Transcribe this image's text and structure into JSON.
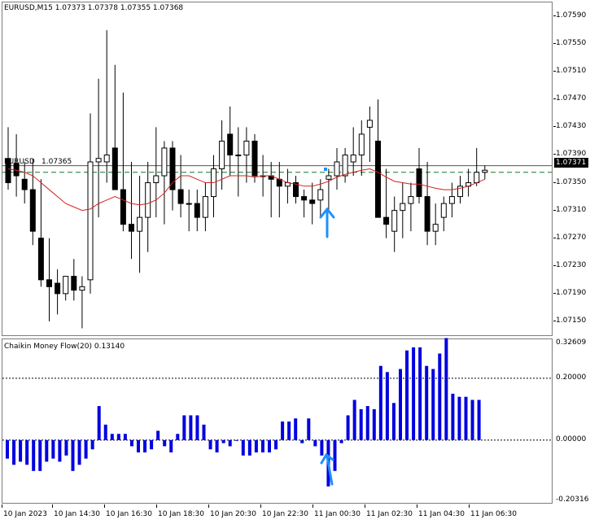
{
  "main_chart": {
    "title": "EURUSD,M15  1.07373 1.07378 1.07355 1.07368",
    "ma_label": "1.07365",
    "ma_prefix": "EURUSD",
    "current_price": "1.07371",
    "price_levels": [
      "1.07590",
      "1.07550",
      "1.07510",
      "1.07470",
      "1.07430",
      "1.07390",
      "1.07350",
      "1.07310",
      "1.07270",
      "1.07230",
      "1.07190",
      "1.07150"
    ],
    "colors": {
      "bull": "#ffffff",
      "bear": "#000000",
      "ma": "#d42020",
      "dashed": "#0a7a2a",
      "arrow": "#1e90ff"
    }
  },
  "indicator": {
    "title": "Chaikin Money Flow(20) 0.13140",
    "levels": [
      "0.32609",
      "0.20000",
      "0.00000",
      "-0.20316"
    ],
    "bar_color": "#0000e0"
  },
  "time_axis": [
    "10 Jan 2023",
    "10 Jan 14:30",
    "10 Jan 16:30",
    "10 Jan 18:30",
    "10 Jan 20:30",
    "10 Jan 22:30",
    "11 Jan 00:30",
    "11 Jan 02:30",
    "11 Jan 04:30",
    "11 Jan 06:30"
  ],
  "chart_data": [
    {
      "type": "candlestick",
      "title": "EURUSD,M15",
      "ohlc_open": [
        1.07385,
        1.07378,
        1.07355,
        1.0734,
        1.0727,
        1.0721,
        1.07205,
        1.0719,
        1.07215,
        1.07195,
        1.0721,
        1.0738,
        1.0738,
        1.074,
        1.0734,
        1.0729,
        1.0728,
        1.073,
        1.0735,
        1.0736,
        1.074,
        1.0734,
        1.0732,
        1.0732,
        1.073,
        1.0733,
        1.0737,
        1.0742,
        1.0739,
        1.0739,
        1.0741,
        1.0736,
        1.0736,
        1.07355,
        1.07345,
        1.0735,
        1.0733,
        1.07325,
        1.07325,
        1.07355,
        1.0736,
        1.0736,
        1.0738,
        1.0739,
        1.0743,
        1.0741,
        1.073,
        1.0728,
        1.0731,
        1.0732,
        1.0737,
        1.0733,
        1.0728,
        1.073,
        1.0732,
        1.0733,
        1.07345,
        1.0735,
        1.07365
      ],
      "ohlc_high": [
        1.0743,
        1.0742,
        1.0738,
        1.07385,
        1.07355,
        1.0727,
        1.07225,
        1.07215,
        1.0724,
        1.07215,
        1.0745,
        1.075,
        1.0757,
        1.0752,
        1.0748,
        1.0738,
        1.0736,
        1.0738,
        1.0743,
        1.0741,
        1.0741,
        1.0739,
        1.0734,
        1.0734,
        1.0735,
        1.0739,
        1.0744,
        1.0746,
        1.0743,
        1.0743,
        1.0742,
        1.0739,
        1.0738,
        1.0738,
        1.0737,
        1.0736,
        1.0734,
        1.0735,
        1.07355,
        1.0737,
        1.074,
        1.074,
        1.0743,
        1.0744,
        1.0746,
        1.0747,
        1.0737,
        1.0733,
        1.0735,
        1.0735,
        1.074,
        1.0738,
        1.0732,
        1.0733,
        1.0735,
        1.0736,
        1.0737,
        1.074,
        1.07375
      ],
      "ohlc_low": [
        1.0734,
        1.0733,
        1.0732,
        1.0726,
        1.072,
        1.0715,
        1.0716,
        1.0718,
        1.0718,
        1.0714,
        1.0719,
        1.073,
        1.0735,
        1.0734,
        1.0728,
        1.0724,
        1.0722,
        1.0725,
        1.073,
        1.0729,
        1.0731,
        1.073,
        1.0728,
        1.0728,
        1.0728,
        1.073,
        1.0734,
        1.0736,
        1.0733,
        1.0735,
        1.0735,
        1.0733,
        1.073,
        1.073,
        1.0732,
        1.0732,
        1.073,
        1.0729,
        1.073,
        1.0731,
        1.0734,
        1.0735,
        1.0736,
        1.0736,
        1.0738,
        1.0731,
        1.0727,
        1.0725,
        1.0727,
        1.0728,
        1.0732,
        1.0726,
        1.0726,
        1.0728,
        1.073,
        1.0732,
        1.0733,
        1.07345,
        1.07355
      ],
      "ohlc_close": [
        1.0735,
        1.0736,
        1.0734,
        1.0728,
        1.0721,
        1.072,
        1.0719,
        1.07215,
        1.07195,
        1.072,
        1.0738,
        1.07385,
        1.0739,
        1.0734,
        1.0729,
        1.0728,
        1.073,
        1.0735,
        1.0736,
        1.074,
        1.0734,
        1.0732,
        1.0732,
        1.073,
        1.0733,
        1.0737,
        1.0741,
        1.0739,
        1.0739,
        1.0741,
        1.0736,
        1.0736,
        1.07355,
        1.07345,
        1.0735,
        1.0733,
        1.07325,
        1.0732,
        1.0734,
        1.0736,
        1.0738,
        1.0739,
        1.0739,
        1.0742,
        1.0744,
        1.073,
        1.0729,
        1.0731,
        1.0732,
        1.0733,
        1.0733,
        1.0728,
        1.0729,
        1.0732,
        1.0733,
        1.07345,
        1.0735,
        1.07365,
        1.07368
      ],
      "ylim": [
        1.0713,
        1.0761
      ],
      "ma_values": [
        1.0737,
        1.07368,
        1.07365,
        1.0736,
        1.0735,
        1.0734,
        1.0733,
        1.0732,
        1.07315,
        1.0731,
        1.07312,
        1.0732,
        1.07325,
        1.0733,
        1.07325,
        1.0732,
        1.07318,
        1.0732,
        1.07325,
        1.07335,
        1.0735,
        1.0736,
        1.0736,
        1.07355,
        1.0735,
        1.0735,
        1.07355,
        1.0736,
        1.0736,
        1.0736,
        1.07358,
        1.0736,
        1.0736,
        1.07355,
        1.0735,
        1.07348,
        1.07345,
        1.07345,
        1.07348,
        1.07352,
        1.07358,
        1.07362,
        1.07365,
        1.07368,
        1.0737,
        1.07365,
        1.07358,
        1.07352,
        1.0735,
        1.07348,
        1.07348,
        1.07345,
        1.07342,
        1.0734,
        1.0734,
        1.07342,
        1.07345,
        1.0735,
        1.07355
      ],
      "dashed_level": 1.07365
    },
    {
      "type": "bar",
      "title": "Chaikin Money Flow(20) 0.13140",
      "values": [
        -0.06,
        -0.08,
        -0.07,
        -0.08,
        -0.1,
        -0.1,
        -0.07,
        -0.06,
        -0.07,
        -0.05,
        -0.1,
        -0.08,
        -0.06,
        -0.03,
        0.11,
        0.05,
        0.02,
        0.02,
        0.02,
        -0.02,
        -0.04,
        -0.04,
        -0.03,
        0.03,
        -0.02,
        -0.04,
        0.02,
        0.08,
        0.08,
        0.08,
        0.05,
        -0.03,
        -0.04,
        -0.01,
        -0.02,
        0.0,
        -0.05,
        -0.05,
        -0.04,
        -0.04,
        -0.04,
        -0.03,
        0.06,
        0.06,
        0.07,
        -0.01,
        0.07,
        -0.02,
        -0.05,
        -0.15,
        -0.1,
        -0.01,
        0.08,
        0.13,
        0.1,
        0.11,
        0.1,
        0.24,
        0.22,
        0.12,
        0.23,
        0.29,
        0.3,
        0.3,
        0.24,
        0.23,
        0.28,
        0.33,
        0.15,
        0.14,
        0.14,
        0.13,
        0.13
      ],
      "ylim": [
        -0.20316,
        0.32609
      ],
      "reference_line": 0.2
    }
  ]
}
